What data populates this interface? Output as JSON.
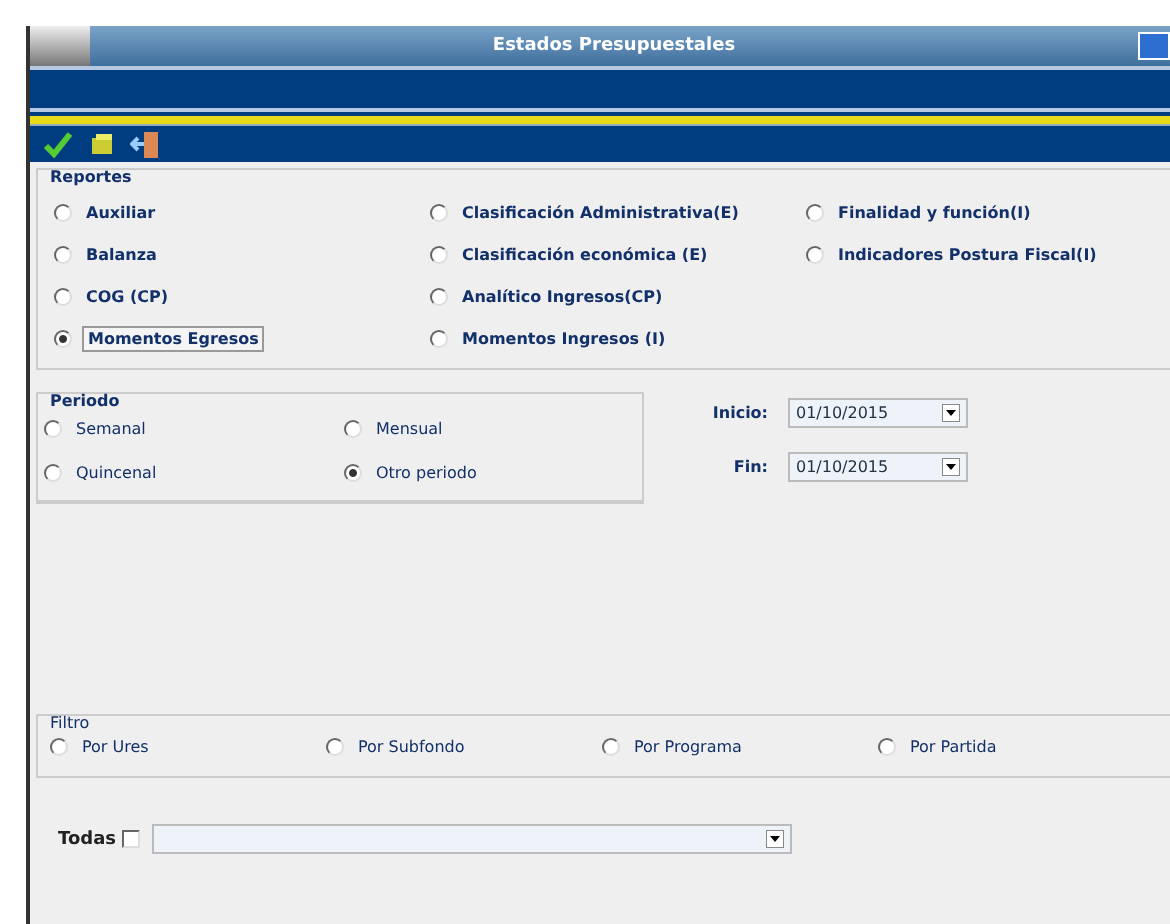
{
  "window": {
    "title": "Estados Presupuestales"
  },
  "toolbar": [
    {
      "kind": "accept"
    },
    {
      "kind": "edit"
    },
    {
      "kind": "exit"
    }
  ],
  "reportes": {
    "title": "Reportes",
    "columns": [
      [
        {
          "label": "Auxiliar",
          "selected": false,
          "focused": false
        },
        {
          "label": "Balanza",
          "selected": false,
          "focused": false
        },
        {
          "label": "COG (CP)",
          "selected": false,
          "focused": false
        },
        {
          "label": "Momentos Egresos",
          "selected": true,
          "focused": true
        }
      ],
      [
        {
          "label": "Clasificación Administrativa(E)",
          "selected": false,
          "focused": false
        },
        {
          "label": "Clasificación económica (E)",
          "selected": false,
          "focused": false
        },
        {
          "label": "Analítico Ingresos(CP)",
          "selected": false,
          "focused": false
        },
        {
          "label": "Momentos Ingresos (I)",
          "selected": false,
          "focused": false
        }
      ],
      [
        {
          "label": "Finalidad y función(I)",
          "selected": false,
          "focused": false
        },
        {
          "label": "Indicadores Postura Fiscal(I)",
          "selected": false,
          "focused": false
        }
      ]
    ]
  },
  "periodo": {
    "title": "Periodo",
    "options": [
      {
        "label": "Semanal",
        "selected": false
      },
      {
        "label": "Mensual",
        "selected": false
      },
      {
        "label": "Quincenal",
        "selected": false
      },
      {
        "label": "Otro periodo",
        "selected": true
      }
    ]
  },
  "dates": [
    {
      "label": "Inicio:",
      "value": "01/10/2015"
    },
    {
      "label": "Fin:",
      "value": "01/10/2015"
    }
  ],
  "filtro": {
    "title": "Filtro",
    "options": [
      {
        "label": "Por Ures",
        "selected": false
      },
      {
        "label": "Por Subfondo",
        "selected": false
      },
      {
        "label": "Por Programa",
        "selected": false
      },
      {
        "label": "Por Partida",
        "selected": false
      }
    ]
  },
  "todas": {
    "label": "Todas",
    "checked": false
  }
}
